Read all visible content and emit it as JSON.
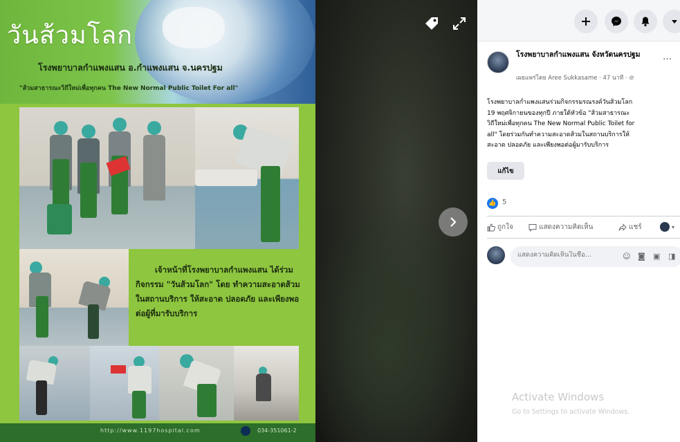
{
  "poster": {
    "title": "วันส้วมโลก",
    "organization": "โรงพยาบาลกำแพงแสน  อ.กำแพงแสน  จ.นครปฐม",
    "campaign": "\"ส้วมสาธารณะวิถีใหม่เพื่อทุกคน The New Normal Public Toilet For  all\"",
    "description": "เจ้าหน้าที่โรงพยาบาลกำแพงแสน ได้ร่วมกิจกรรม \"วันส้วมโลก\" โดย ทำความสะอาดส้วมในสถานบริการ ให้สะอาด  ปลอดภัย  และเพียงพอ ต่อผู้ที่มารับบริการ",
    "footer_url": "http://www.1197hospital.com",
    "footer_phone": "034-351061-2"
  },
  "viewer": {
    "tag_icon": "tag-icon",
    "expand_icon": "expand-icon",
    "next_icon": "chevron-right-icon"
  },
  "topbar": {
    "plus_icon": "plus-icon",
    "messenger_icon": "messenger-icon",
    "notifications_icon": "bell-icon",
    "account_icon": "caret-down-icon"
  },
  "post": {
    "page_name": "โรงพยาบาลกำแพงแสน จังหวัดนครปฐม",
    "meta": "เผยแพร่โดย Aree Sukkasame · 47 นาที ·",
    "text_lines": [
      "โรงพยาบาลกำแพงแสนร่วมกิจกรรมรณรงค์วันส้วมโลก",
      "19 พฤศจิกายนของทุกปี ภายใต้หัวข้อ \"ส้วมสาธารณะ",
      "วิถีใหม่เพื่อทุกคน The New Normal Public Toilet for",
      "all\" โดยร่วมกันทำความสะอาดส้วมในสถานบริการให้",
      "สะอาด ปลอดภัย และเพียงพอต่อผู้มารับบริการ"
    ],
    "edit_label": "แก้ไข",
    "like_count": "5",
    "actions": {
      "like": "ถูกใจ",
      "comment": "แสดงความคิดเห็น",
      "share": "แชร์"
    },
    "comment_placeholder": "แสดงความคิดเห็นในชื่อ..."
  },
  "watermark": {
    "title": "Activate Windows",
    "subtitle": "Go to Settings to activate Windows."
  },
  "colors": {
    "poster_green": "#8ec63f",
    "facebook_blue": "#1877f2",
    "panel_bg": "#ffffff"
  }
}
